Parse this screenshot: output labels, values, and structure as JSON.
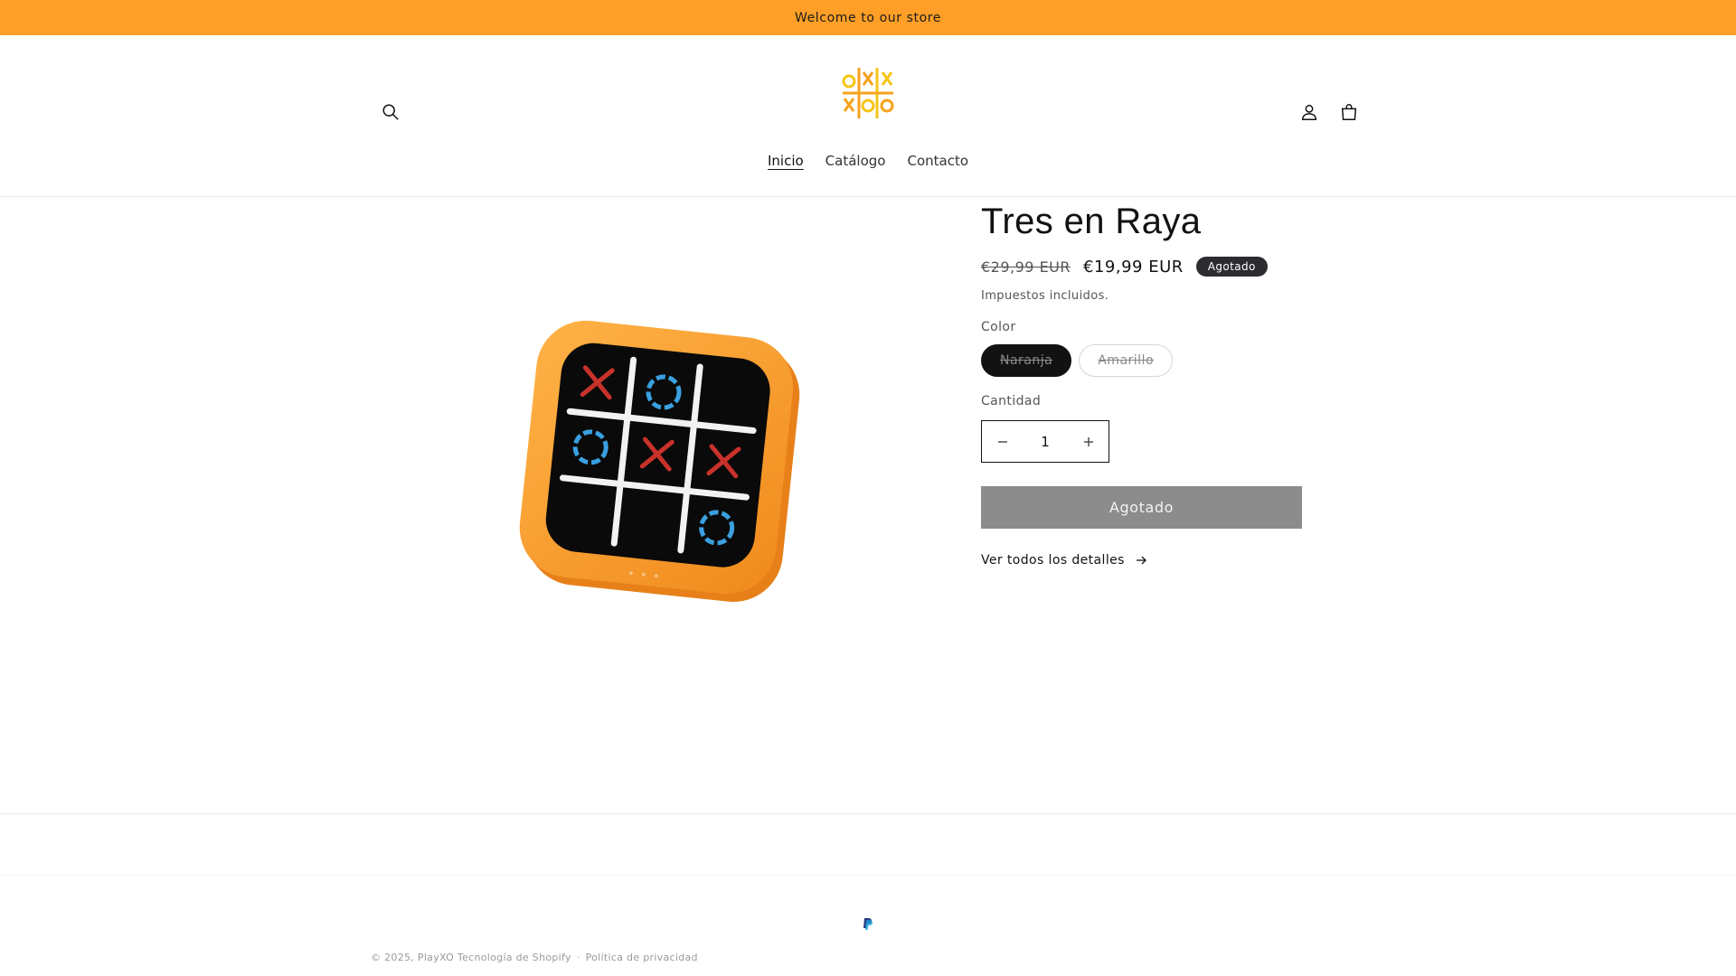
{
  "announcement": {
    "text": "Welcome to our store"
  },
  "header": {
    "icons": {
      "search": "search-icon",
      "account": "user-icon",
      "cart": "cart-icon",
      "logo": "tic-tac-toe-logo"
    },
    "nav": [
      {
        "label": "Inicio",
        "active": true
      },
      {
        "label": "Catálogo",
        "active": false
      },
      {
        "label": "Contacto",
        "active": false
      }
    ]
  },
  "product": {
    "title": "Tres en Raya",
    "price_old": "€29,99 EUR",
    "price_new": "€19,99 EUR",
    "badge": "Agotado",
    "tax_note": "Impuestos incluidos.",
    "color_label": "Color",
    "colors": [
      {
        "label": "Naranja",
        "selected": true
      },
      {
        "label": "Amarillo",
        "selected": false
      }
    ],
    "quantity_label": "Cantidad",
    "quantity_value": "1",
    "sold_out_button": "Agotado",
    "details_link": "Ver todos los detalles"
  },
  "footer": {
    "copyright": "© 2025, PlayXO Tecnología de Shopify",
    "privacy_link": "Política de privacidad",
    "payment_icon": "paypal-icon"
  },
  "colors": {
    "announcement_bg": "#ff9f27",
    "logo_orange": "#f7a21c",
    "logo_yellow": "#f5c518",
    "badge_bg": "#2b2b30",
    "sold_out_bg": "#8c8c8c"
  }
}
